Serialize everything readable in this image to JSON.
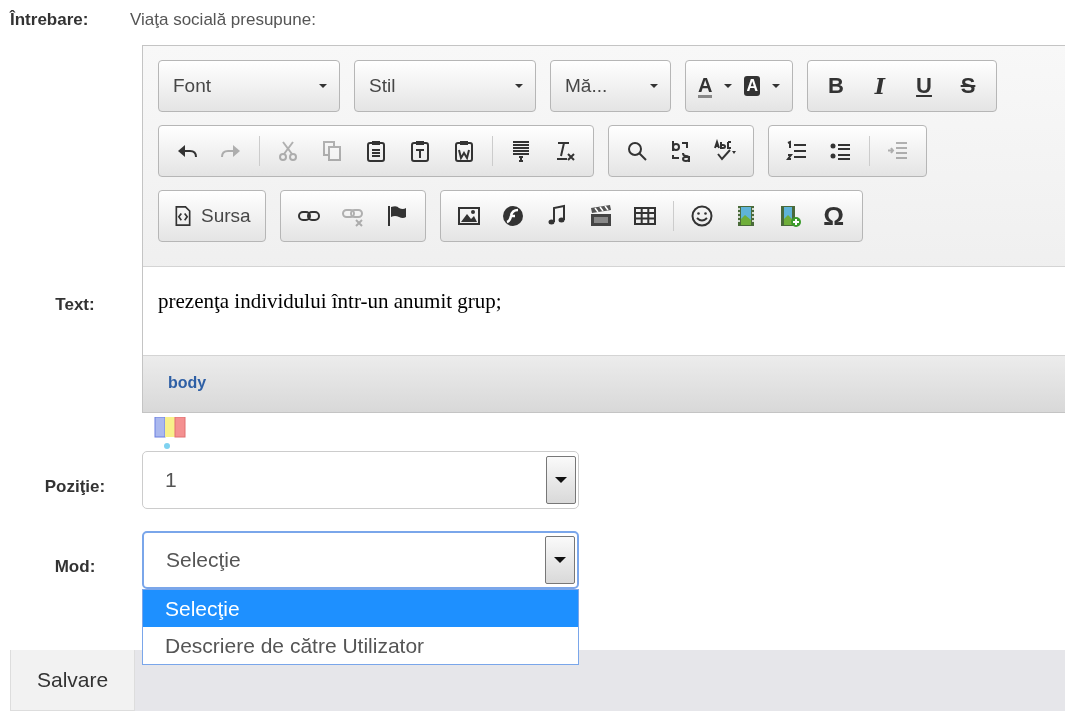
{
  "question": {
    "label": "Întrebare:",
    "value": "Viaţa socială presupune:"
  },
  "editor": {
    "label": "Text:",
    "toolbar": [
      {
        "groups": [
          {
            "items": [
              {
                "kind": "combo",
                "label": "Font"
              }
            ]
          },
          {
            "items": [
              {
                "kind": "combo",
                "label": "Stil"
              }
            ]
          },
          {
            "items": [
              {
                "kind": "combo",
                "label": "Mă..."
              }
            ]
          },
          {
            "items": [
              {
                "kind": "color",
                "label": "A"
              },
              {
                "kind": "color",
                "label": "A"
              }
            ]
          },
          {
            "items": [
              {
                "kind": "format",
                "label": "B"
              },
              {
                "kind": "format",
                "label": "I"
              },
              {
                "kind": "format",
                "label": "U"
              },
              {
                "kind": "format",
                "label": "S"
              }
            ]
          }
        ]
      },
      {
        "groups": [
          {
            "items": [
              {
                "kind": "icon",
                "disabled": false
              },
              {
                "kind": "icon",
                "disabled": true
              },
              {
                "kind": "separator"
              },
              {
                "kind": "icon",
                "disabled": true
              },
              {
                "kind": "icon",
                "disabled": true
              },
              {
                "kind": "icon",
                "disabled": false
              },
              {
                "kind": "icon",
                "disabled": false
              },
              {
                "kind": "icon",
                "disabled": false
              },
              {
                "kind": "separator"
              },
              {
                "kind": "icon",
                "disabled": false
              },
              {
                "kind": "icon",
                "disabled": false
              }
            ]
          },
          {
            "items": [
              {
                "kind": "icon",
                "disabled": false
              },
              {
                "kind": "icon",
                "disabled": false
              },
              {
                "kind": "icon",
                "disabled": false
              }
            ]
          },
          {
            "items": [
              {
                "kind": "icon",
                "disabled": false
              },
              {
                "kind": "icon",
                "disabled": false
              },
              {
                "kind": "separator"
              },
              {
                "kind": "icon",
                "disabled": true
              }
            ]
          }
        ]
      },
      {
        "groups": [
          {
            "items": [
              {
                "kind": "labeled",
                "label": "Sursa"
              }
            ]
          },
          {
            "items": [
              {
                "kind": "icon",
                "disabled": false
              },
              {
                "kind": "icon",
                "disabled": true
              },
              {
                "kind": "icon",
                "disabled": false
              }
            ]
          },
          {
            "items": [
              {
                "kind": "icon",
                "disabled": false
              },
              {
                "kind": "icon",
                "disabled": false
              },
              {
                "kind": "icon",
                "disabled": false
              },
              {
                "kind": "icon",
                "disabled": false
              },
              {
                "kind": "icon",
                "disabled": false
              },
              {
                "kind": "separator"
              },
              {
                "kind": "icon",
                "disabled": false
              },
              {
                "kind": "icon",
                "disabled": false
              },
              {
                "kind": "icon",
                "disabled": false
              },
              {
                "kind": "symbol",
                "label": "Ω"
              }
            ]
          }
        ]
      }
    ],
    "content": "prezenţa individului într-un anumit grup;",
    "path": "body"
  },
  "position": {
    "label": "Poziţie:",
    "value": "1"
  },
  "mode": {
    "label": "Mod:",
    "value": "Selecţie",
    "expanded": true,
    "options": [
      {
        "label": "Selecţie",
        "selected": true
      },
      {
        "label": "Descriere de către Utilizator",
        "selected": false
      }
    ]
  },
  "buttons": [
    "Salvare"
  ]
}
